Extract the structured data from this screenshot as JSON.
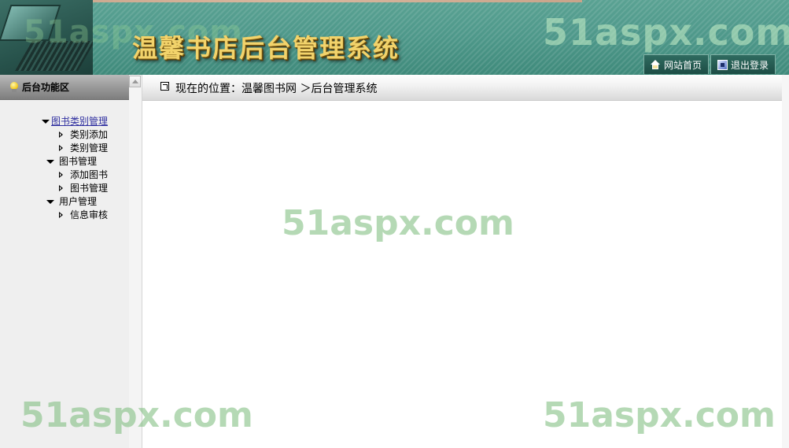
{
  "header": {
    "title": "温馨书店后台管理系统",
    "watermark": "51aspx.com",
    "nav": [
      {
        "label": "网站首页",
        "icon": "home-icon"
      },
      {
        "label": "退出登录",
        "icon": "exit-icon"
      }
    ]
  },
  "sidebar": {
    "title": "后台功能区",
    "groups": [
      {
        "label": "图书类别管理",
        "active": true,
        "items": [
          "类别添加",
          "类别管理"
        ]
      },
      {
        "label": "图书管理",
        "items": [
          "添加图书",
          "图书管理"
        ]
      },
      {
        "label": "用户管理",
        "items": [
          "信息审核"
        ]
      }
    ]
  },
  "breadcrumb": {
    "text": "现在的位置：温馨图书网 ＞后台管理系统"
  },
  "watermark": "51aspx.com",
  "colors": {
    "header_bg": "#4f998b",
    "title_gold": "#f2d36b",
    "sidebar_bg": "#efefef",
    "active_link": "#3030a0",
    "watermark_green": "#78b978"
  }
}
